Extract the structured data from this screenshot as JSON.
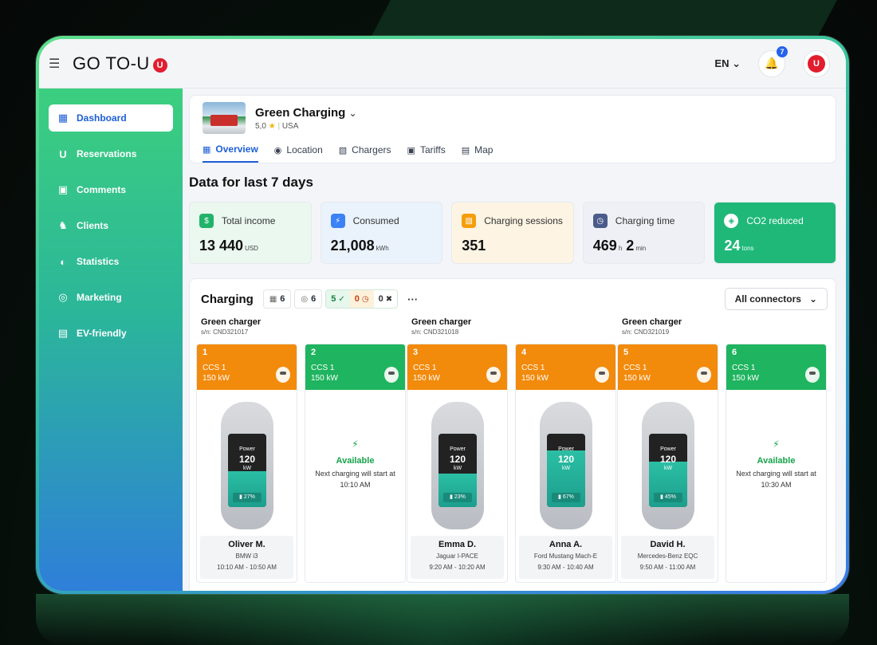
{
  "topbar": {
    "logo": "GO TO-U",
    "badge": "U",
    "lang": "EN",
    "notifications": "7"
  },
  "sidebar": {
    "items": [
      {
        "label": "Dashboard",
        "icon": "dashboard-icon",
        "active": true
      },
      {
        "label": "Reservations",
        "icon": "reservations-icon"
      },
      {
        "label": "Comments",
        "icon": "comments-icon"
      },
      {
        "label": "Clients",
        "icon": "clients-icon"
      },
      {
        "label": "Statistics",
        "icon": "statistics-icon"
      },
      {
        "label": "Marketing",
        "icon": "marketing-icon"
      },
      {
        "label": "EV-friendly",
        "icon": "ev-friendly-icon"
      }
    ]
  },
  "station": {
    "name": "Green Charging",
    "rating": "5,0",
    "country": "USA",
    "tabs": [
      {
        "label": "Overview",
        "icon": "overview-icon",
        "active": true
      },
      {
        "label": "Location",
        "icon": "location-icon"
      },
      {
        "label": "Chargers",
        "icon": "chargers-icon"
      },
      {
        "label": "Tariffs",
        "icon": "tariffs-icon"
      },
      {
        "label": "Map",
        "icon": "map-icon"
      }
    ]
  },
  "overview": {
    "title": "Data for last 7 days",
    "stats": [
      {
        "label": "Total income",
        "value": "13 440",
        "unit": "USD",
        "icon": "income-icon",
        "bg": "#eaf8ef",
        "iconbg": "#22b36a"
      },
      {
        "label": "Consumed",
        "value": "21,008",
        "unit": "kWh",
        "icon": "lightning-icon",
        "bg": "#eaf2fc",
        "iconbg": "#3b82f6"
      },
      {
        "label": "Charging sessions",
        "value": "351",
        "unit": "",
        "icon": "sessions-icon",
        "bg": "#fdf4e3",
        "iconbg": "#f59e0b"
      },
      {
        "label": "Charging time",
        "value_h": "469",
        "unit_h": "h",
        "value_m": "2",
        "unit_m": "min",
        "icon": "clock-icon",
        "bg": "#eef0f5",
        "iconbg": "#4b5b8a"
      },
      {
        "label": "CO2 reduced",
        "value": "24",
        "unit": "tons",
        "icon": "leaf-icon",
        "bg": "#1fb879",
        "iconbg": "#ffffff"
      }
    ]
  },
  "charging": {
    "title": "Charging",
    "chips": {
      "chargers": "6",
      "connectors": "6",
      "available": "5",
      "busy": "0",
      "faulty": "0"
    },
    "more": "···",
    "filter": "All connectors",
    "groups": [
      {
        "name": "Green charger",
        "sn": "s/n: CND321017",
        "connectors": [
          {
            "num": "1",
            "type": "CCS 1",
            "power": "150 kW",
            "status": "busy",
            "power_label": "Power",
            "power_value": "120",
            "power_unit": "kW",
            "battery": "27%",
            "battery_level": 0.27,
            "driver": "Oliver M.",
            "car": "BMW i3",
            "time": "10:10 AM - 10:50 AM"
          },
          {
            "num": "2",
            "type": "CCS 1",
            "power": "150 kW",
            "status": "available",
            "avail_text": "Available",
            "avail_next": "Next charging will start at 10:10 AM"
          }
        ]
      },
      {
        "name": "Green charger",
        "sn": "s/n: CND321018",
        "connectors": [
          {
            "num": "3",
            "type": "CCS 1",
            "power": "150 kW",
            "status": "busy",
            "power_label": "Power",
            "power_value": "120",
            "power_unit": "kW",
            "battery": "23%",
            "battery_level": 0.23,
            "driver": "Emma D.",
            "car": "Jaguar I-PACE",
            "time": "9:20 AM - 10:20 AM"
          },
          {
            "num": "4",
            "type": "CCS 1",
            "power": "150 kW",
            "status": "busy",
            "power_label": "Power",
            "power_value": "120",
            "power_unit": "kW",
            "battery": "67%",
            "battery_level": 0.67,
            "driver": "Anna A.",
            "car": "Ford Mustang Mach-E",
            "time": "9:30 AM - 10:40 AM"
          }
        ]
      },
      {
        "name": "Green charger",
        "sn": "s/n: CND321019",
        "connectors": [
          {
            "num": "5",
            "type": "CCS 1",
            "power": "150 kW",
            "status": "busy",
            "power_label": "Power",
            "power_value": "120",
            "power_unit": "kW",
            "battery": "45%",
            "battery_level": 0.45,
            "driver": "David H.",
            "car": "Mercedes-Benz EQC",
            "time": "9:50 AM - 11:00 AM"
          },
          {
            "num": "6",
            "type": "CCS 1",
            "power": "150 kW",
            "status": "available",
            "avail_text": "Available",
            "avail_next": "Next charging will start at 10:30 AM"
          }
        ]
      }
    ]
  },
  "colors": {
    "busy": "#f28a0c",
    "available": "#1fb45f",
    "accent": "#1d5fd6"
  }
}
